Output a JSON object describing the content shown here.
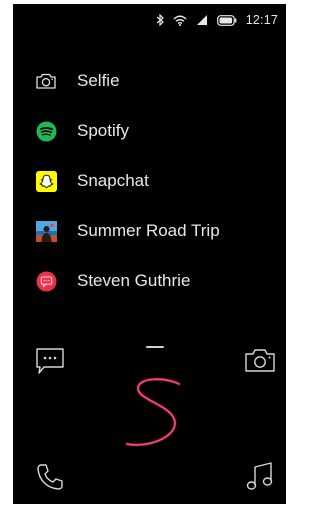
{
  "status_bar": {
    "icons": [
      "bluetooth-icon",
      "wifi-icon",
      "signal-icon",
      "battery-icon"
    ],
    "time": "12:17"
  },
  "recent_list": [
    {
      "label": "Selfie",
      "icon": "camera-icon"
    },
    {
      "label": "Spotify",
      "icon": "spotify-icon"
    },
    {
      "label": "Snapchat",
      "icon": "snapchat-icon"
    },
    {
      "label": "Summer Road Trip",
      "icon": "photo-thumbnail-icon"
    },
    {
      "label": "Steven Guthrie",
      "icon": "contact-avatar-icon"
    }
  ],
  "shortcuts": {
    "top_left": "message-icon",
    "top_right": "camera-icon",
    "bottom_left": "phone-icon",
    "bottom_right": "music-note-icon"
  },
  "colors": {
    "background": "#000000",
    "text": "#e8e8e8",
    "spotify": "#1db954",
    "snapchat": "#fffc00",
    "contact": "#e8344a",
    "gesture": "#ff2d6f"
  }
}
